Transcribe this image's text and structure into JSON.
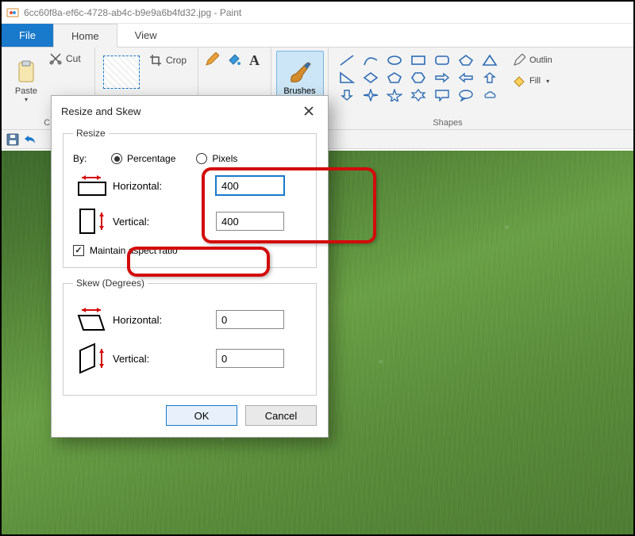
{
  "app": {
    "title_filename": "6cc60f8a-ef6c-4728-ab4c-b9e9a6b4fd32.jpg",
    "title_app": "Paint"
  },
  "tabs": {
    "file": "File",
    "home": "Home",
    "view": "View"
  },
  "ribbon": {
    "clipboard": {
      "label": "Cl",
      "paste": "Paste",
      "cut": "Cut"
    },
    "image": {
      "crop": "Crop"
    },
    "brushes": {
      "label": "Brushes"
    },
    "shapes": {
      "label": "Shapes",
      "outline": "Outlin",
      "fill": "Fill"
    }
  },
  "dialog": {
    "title": "Resize and Skew",
    "resize_legend": "Resize",
    "by_label": "By:",
    "radio_percentage": "Percentage",
    "radio_pixels": "Pixels",
    "horizontal_label": "Horizontal:",
    "vertical_label": "Vertical:",
    "horizontal_value": "400",
    "vertical_value": "400",
    "maintain_label": "Maintain aspect ratio",
    "skew_legend": "Skew (Degrees)",
    "skew_h_value": "0",
    "skew_v_value": "0",
    "ok": "OK",
    "cancel": "Cancel"
  }
}
